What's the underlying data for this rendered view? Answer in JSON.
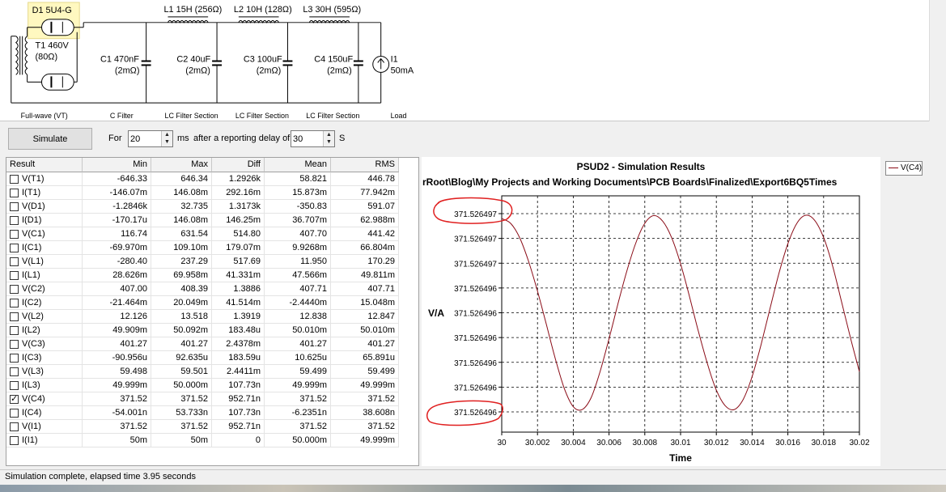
{
  "schematic": {
    "rectifier": {
      "label": "D1 5U4-G",
      "caption": "Full-wave (VT)"
    },
    "transformer": {
      "label": "T1 460V",
      "resistance": "(80Ω)"
    },
    "c1": {
      "label": "C1 470nF",
      "esr": "(2mΩ)",
      "caption": "C Filter"
    },
    "l1": {
      "label": "L1 15H (256Ω)"
    },
    "c2": {
      "label": "C2 40uF",
      "esr": "(2mΩ)",
      "caption": "LC Filter Section"
    },
    "l2": {
      "label": "L2 10H (128Ω)"
    },
    "c3": {
      "label": "C3 100uF",
      "esr": "(2mΩ)",
      "caption": "LC Filter Section"
    },
    "l3": {
      "label": "L3 30H (595Ω)"
    },
    "c4": {
      "label": "C4 150uF",
      "esr": "(2mΩ)",
      "caption": "LC Filter Section"
    },
    "load": {
      "label": "I1",
      "value": "50mA",
      "caption": "Load"
    }
  },
  "toolbar": {
    "simulate_label": "Simulate",
    "for_label": "For",
    "duration_value": "20",
    "ms_label": "ms",
    "delay_label": "after a reporting delay of",
    "delay_value": "30",
    "s_label": "S"
  },
  "results": {
    "headers": [
      "Result",
      "Min",
      "Max",
      "Diff",
      "Mean",
      "RMS"
    ],
    "rows": [
      {
        "name": "V(T1)",
        "checked": false,
        "min": "-646.33",
        "max": "646.34",
        "diff": "1.2926k",
        "mean": "58.821",
        "rms": "446.78"
      },
      {
        "name": "I(T1)",
        "checked": false,
        "min": "-146.07m",
        "max": "146.08m",
        "diff": "292.16m",
        "mean": "15.873m",
        "rms": "77.942m"
      },
      {
        "name": "V(D1)",
        "checked": false,
        "min": "-1.2846k",
        "max": "32.735",
        "diff": "1.3173k",
        "mean": "-350.83",
        "rms": "591.07"
      },
      {
        "name": "I(D1)",
        "checked": false,
        "min": "-170.17u",
        "max": "146.08m",
        "diff": "146.25m",
        "mean": "36.707m",
        "rms": "62.988m"
      },
      {
        "name": "V(C1)",
        "checked": false,
        "min": "116.74",
        "max": "631.54",
        "diff": "514.80",
        "mean": "407.70",
        "rms": "441.42"
      },
      {
        "name": "I(C1)",
        "checked": false,
        "min": "-69.970m",
        "max": "109.10m",
        "diff": "179.07m",
        "mean": "9.9268m",
        "rms": "66.804m"
      },
      {
        "name": "V(L1)",
        "checked": false,
        "min": "-280.40",
        "max": "237.29",
        "diff": "517.69",
        "mean": "11.950",
        "rms": "170.29"
      },
      {
        "name": "I(L1)",
        "checked": false,
        "min": "28.626m",
        "max": "69.958m",
        "diff": "41.331m",
        "mean": "47.566m",
        "rms": "49.811m"
      },
      {
        "name": "V(C2)",
        "checked": false,
        "min": "407.00",
        "max": "408.39",
        "diff": "1.3886",
        "mean": "407.71",
        "rms": "407.71"
      },
      {
        "name": "I(C2)",
        "checked": false,
        "min": "-21.464m",
        "max": "20.049m",
        "diff": "41.514m",
        "mean": "-2.4440m",
        "rms": "15.048m"
      },
      {
        "name": "V(L2)",
        "checked": false,
        "min": "12.126",
        "max": "13.518",
        "diff": "1.3919",
        "mean": "12.838",
        "rms": "12.847"
      },
      {
        "name": "I(L2)",
        "checked": false,
        "min": "49.909m",
        "max": "50.092m",
        "diff": "183.48u",
        "mean": "50.010m",
        "rms": "50.010m"
      },
      {
        "name": "V(C3)",
        "checked": false,
        "min": "401.27",
        "max": "401.27",
        "diff": "2.4378m",
        "mean": "401.27",
        "rms": "401.27"
      },
      {
        "name": "I(C3)",
        "checked": false,
        "min": "-90.956u",
        "max": "92.635u",
        "diff": "183.59u",
        "mean": "10.625u",
        "rms": "65.891u"
      },
      {
        "name": "V(L3)",
        "checked": false,
        "min": "59.498",
        "max": "59.501",
        "diff": "2.4411m",
        "mean": "59.499",
        "rms": "59.499"
      },
      {
        "name": "I(L3)",
        "checked": false,
        "min": "49.999m",
        "max": "50.000m",
        "diff": "107.73n",
        "mean": "49.999m",
        "rms": "49.999m"
      },
      {
        "name": "V(C4)",
        "checked": true,
        "min": "371.52",
        "max": "371.52",
        "diff": "952.71n",
        "mean": "371.52",
        "rms": "371.52"
      },
      {
        "name": "I(C4)",
        "checked": false,
        "min": "-54.001n",
        "max": "53.733n",
        "diff": "107.73n",
        "mean": "-6.2351n",
        "rms": "38.608n"
      },
      {
        "name": "V(I1)",
        "checked": false,
        "min": "371.52",
        "max": "371.52",
        "diff": "952.71n",
        "mean": "371.52",
        "rms": "371.52"
      },
      {
        "name": "I(I1)",
        "checked": false,
        "min": "50m",
        "max": "50m",
        "diff": "0",
        "mean": "50.000m",
        "rms": "49.999m"
      }
    ]
  },
  "chart_data": {
    "type": "line",
    "title": "PSUD2 - Simulation Results",
    "subtitle": "rRoot\\Blog\\My Projects and Working Documents\\PCB Boards\\Finalized\\Export6BQ5Times",
    "xlabel": "Time",
    "ylabel": "V/A",
    "xlim": [
      30,
      30.02
    ],
    "x_ticks": [
      "30",
      "30.002",
      "30.004",
      "30.006",
      "30.008",
      "30.01",
      "30.012",
      "30.014",
      "30.016",
      "30.018",
      "30.02"
    ],
    "y_ticks": [
      "371.526497",
      "371.526497",
      "371.526497",
      "371.526496",
      "371.526496",
      "371.526496",
      "371.526496",
      "371.526496",
      "371.526496"
    ],
    "grid": true,
    "legend_position": "top-right",
    "series": [
      {
        "name": "V(C4)",
        "color": "#8a0b16",
        "x": [
          30.0,
          30.0005,
          30.001,
          30.0015,
          30.002,
          30.0025,
          30.003,
          30.0035,
          30.004,
          30.0045,
          30.005,
          30.0055,
          30.006,
          30.0065,
          30.007,
          30.0075,
          30.008,
          30.0085,
          30.009,
          30.0095,
          30.01,
          30.0105,
          30.011,
          30.0115,
          30.012,
          30.0125,
          30.013,
          30.0135,
          30.014,
          30.0145,
          30.015,
          30.0155,
          30.016,
          30.0165,
          30.017,
          30.0175,
          30.018,
          30.0185,
          30.019,
          30.0195,
          30.02
        ],
        "values": [
          0.975,
          0.951,
          0.879,
          0.759,
          0.609,
          0.439,
          0.267,
          0.118,
          0.026,
          0.012,
          0.072,
          0.204,
          0.369,
          0.545,
          0.712,
          0.853,
          0.951,
          0.99,
          0.962,
          0.879,
          0.747,
          0.581,
          0.405,
          0.243,
          0.11,
          0.031,
          0.012,
          0.063,
          0.178,
          0.339,
          0.521,
          0.698,
          0.848,
          0.951,
          0.992,
          0.966,
          0.879,
          0.737,
          0.556,
          0.373,
          0.203
        ],
        "values_unit": "normalized position between the lowest tick (0) and highest tick (1) — tick labels too coarse for exact voltages"
      }
    ]
  },
  "legend": {
    "label": "V(C4)"
  },
  "status": {
    "text": "Simulation complete, elapsed time 3.95 seconds"
  }
}
